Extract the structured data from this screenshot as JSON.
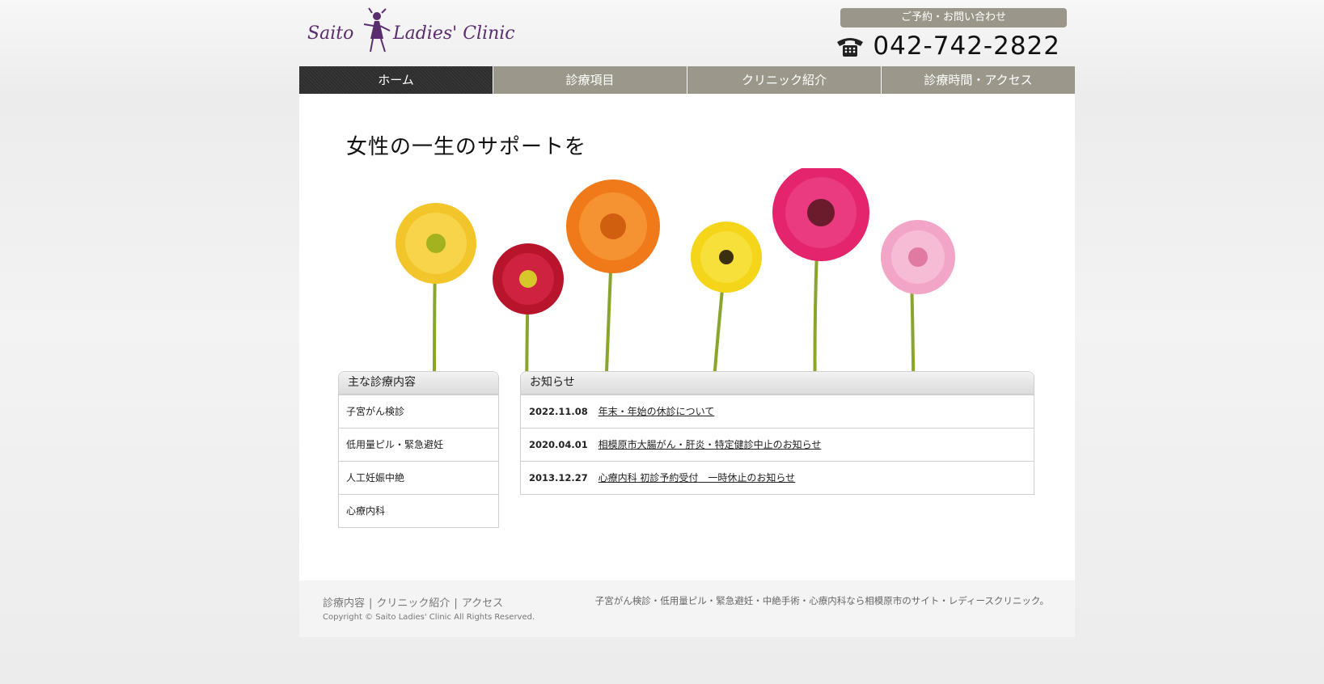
{
  "header": {
    "logo_text": "Saito Ladies' Clinic",
    "contact_label": "ご予約・お問い合わせ",
    "phone_number": "042-742-2822",
    "phone_icon": "telephone-icon"
  },
  "nav": {
    "items": [
      {
        "label": "ホーム",
        "active": true
      },
      {
        "label": "診療項目",
        "active": false
      },
      {
        "label": "クリニック紹介",
        "active": false
      },
      {
        "label": "診療時間・アクセス",
        "active": false
      }
    ]
  },
  "hero": {
    "title": "女性の一生のサポートを"
  },
  "services": {
    "heading": "主な診療内容",
    "items": [
      "子宮がん検診",
      "低用量ピル・緊急避妊",
      "人工妊娠中絶",
      "心療内科"
    ]
  },
  "news": {
    "heading": "お知らせ",
    "items": [
      {
        "date": "2022.11.08",
        "title": "年末・年始の休診について"
      },
      {
        "date": "2020.04.01",
        "title": "相模原市大腸がん・肝炎・特定健診中止のお知らせ"
      },
      {
        "date": "2013.12.27",
        "title": "心療内科 初診予約受付　一時休止のお知らせ"
      }
    ]
  },
  "footer": {
    "links": [
      "診療内容",
      "クリニック紹介",
      "アクセス"
    ],
    "separator": "|",
    "copyright": "Copyright © Saito Ladies' Clinic All Rights Reserved.",
    "description": "子宮がん検診・低用量ピル・緊急避妊・中絶手術・心療内科なら相模原市のサイト・レディースクリニック。"
  },
  "colors": {
    "nav_inactive": "#9b988b",
    "nav_active": "#333333",
    "logo_purple": "#5a2d6e",
    "page_bg": "#f2f2f2"
  }
}
